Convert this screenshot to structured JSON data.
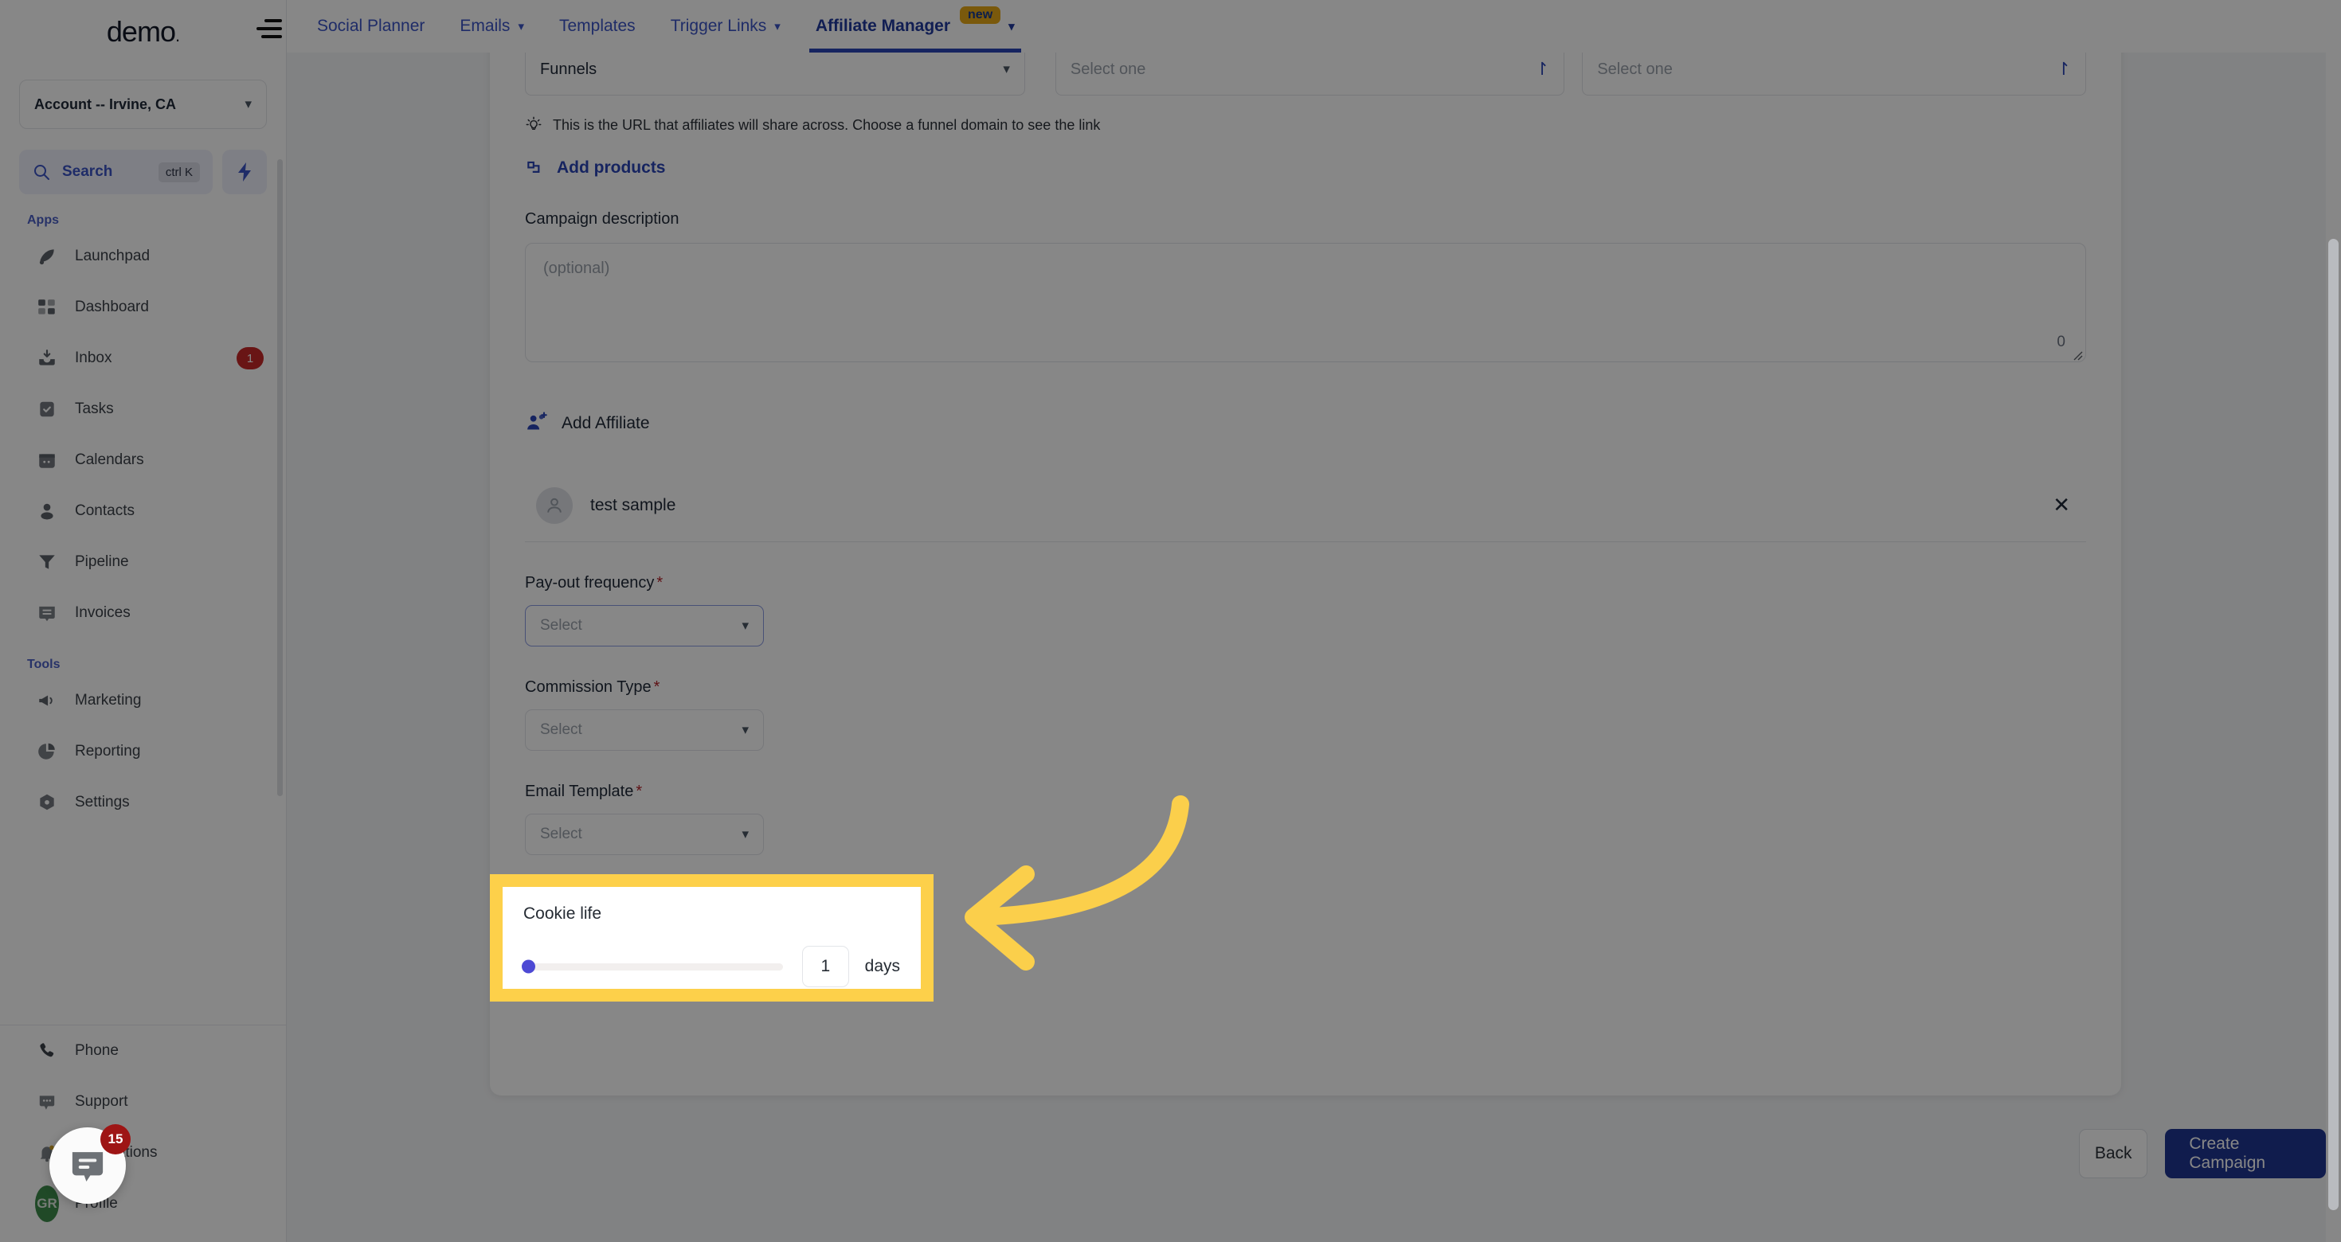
{
  "app": {
    "logo": "demo",
    "logo_dot": "."
  },
  "sidebar": {
    "account": {
      "label": "Account -- Irvine, CA",
      "chevron": "chevron-down"
    },
    "search": {
      "label": "Search",
      "shortcut": "ctrl K"
    },
    "sections": [
      {
        "title": "Apps",
        "items": [
          {
            "label": "Launchpad",
            "icon": "launchpad-icon",
            "badge": ""
          },
          {
            "label": "Dashboard",
            "icon": "dashboard-icon",
            "badge": ""
          },
          {
            "label": "Inbox",
            "icon": "inbox-icon",
            "badge": "1"
          },
          {
            "label": "Tasks",
            "icon": "tasks-icon",
            "badge": ""
          },
          {
            "label": "Calendars",
            "icon": "calendar-icon",
            "badge": ""
          },
          {
            "label": "Contacts",
            "icon": "contacts-icon",
            "badge": ""
          },
          {
            "label": "Pipeline",
            "icon": "pipeline-icon",
            "badge": ""
          },
          {
            "label": "Invoices",
            "icon": "invoices-icon",
            "badge": ""
          }
        ]
      },
      {
        "title": "Tools",
        "items": [
          {
            "label": "Marketing",
            "icon": "megaphone-icon",
            "badge": ""
          },
          {
            "label": "Reporting",
            "icon": "pie-chart-icon",
            "badge": ""
          },
          {
            "label": "Settings",
            "icon": "gear-icon",
            "badge": ""
          }
        ]
      }
    ],
    "bottom_items": [
      {
        "label": "Phone",
        "icon": "phone-icon"
      },
      {
        "label": "Support",
        "icon": "support-chat-icon"
      },
      {
        "label": "Notifications",
        "icon": "bell-icon"
      },
      {
        "label": "Profile",
        "icon": "avatar-icon",
        "initials": "GR"
      }
    ]
  },
  "chat_widget": {
    "badge": "15",
    "icon": "chat-bubble-icon"
  },
  "topbar": {
    "tabs": [
      {
        "label": "Social Planner",
        "has_caret": false,
        "active": false,
        "badge": ""
      },
      {
        "label": "Emails",
        "has_caret": true,
        "active": false,
        "badge": ""
      },
      {
        "label": "Templates",
        "has_caret": false,
        "active": false,
        "badge": ""
      },
      {
        "label": "Trigger Links",
        "has_caret": true,
        "active": false,
        "badge": ""
      },
      {
        "label": "Affiliate Manager",
        "has_caret": true,
        "active": true,
        "badge": "new"
      }
    ]
  },
  "form": {
    "selects_top": [
      {
        "value": "Funnels",
        "placeholder": "",
        "state": "value",
        "icon": "chevron-down-icon"
      },
      {
        "value": "",
        "placeholder": "Select one",
        "state": "loading",
        "icon": "spinner-icon"
      },
      {
        "value": "",
        "placeholder": "Select one",
        "state": "loading",
        "icon": "spinner-icon"
      }
    ],
    "hint": {
      "icon": "lightbulb-icon",
      "text": "This is the URL that affiliates will share across. Choose a funnel domain to see the link"
    },
    "add_products": {
      "label": "Add products",
      "icon": "add-products-icon"
    },
    "campaign_description": {
      "label": "Campaign description",
      "placeholder": "(optional)",
      "value": "",
      "char_count": "0"
    },
    "add_affiliate": {
      "label": "Add Affiliate",
      "icon": "add-affiliate-icon"
    },
    "affiliates": [
      {
        "name": "test sample",
        "avatar_icon": "user-avatar-icon",
        "remove_icon": "close-icon"
      }
    ],
    "fields": [
      {
        "label": "Pay-out frequency",
        "required": "*",
        "placeholder": "Select",
        "focused": true
      },
      {
        "label": "Commission Type",
        "required": "*",
        "placeholder": "Select",
        "focused": false
      },
      {
        "label": "Email Template",
        "required": "*",
        "placeholder": "Select",
        "focused": false
      }
    ],
    "cookie_life": {
      "label": "Cookie life",
      "value": "1",
      "unit": "days",
      "slider_position_pct": 0
    }
  },
  "footer": {
    "back_label": "Back",
    "create_label": "Create Campaign"
  },
  "annotation": {
    "highlight_color": "#fdd04a",
    "arrow_color": "#fbcf4b",
    "target": "cookie-life-section"
  }
}
